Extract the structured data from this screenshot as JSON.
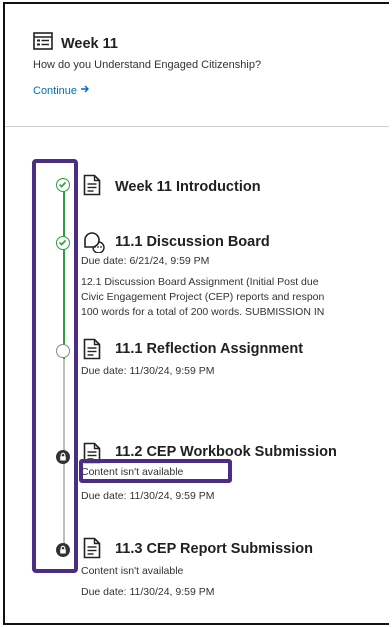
{
  "header": {
    "title": "Week 11",
    "subtitle": "How do you Understand Engaged Citizenship?",
    "continue_label": "Continue"
  },
  "items": [
    {
      "title": "Week 11 Introduction",
      "status": "completed"
    },
    {
      "title": "11.1 Discussion Board",
      "due": "Due date: 6/21/24, 9:59 PM",
      "description": [
        "12.1 Discussion Board Assignment (Initial Post due",
        "Civic Engagement Project (CEP) reports and respon",
        "100 words for a total of 200 words. SUBMISSION IN"
      ],
      "status": "completed"
    },
    {
      "title": "11.1 Reflection Assignment",
      "due": "Due date: 11/30/24, 9:59 PM",
      "status": "not-started"
    },
    {
      "title": "11.2 CEP Workbook Submission",
      "availability": "Content isn't available",
      "due": "Due date: 11/30/24, 9:59 PM",
      "status": "locked"
    },
    {
      "title": "11.3 CEP Report Submission",
      "availability": "Content isn't available",
      "due": "Due date: 11/30/24, 9:59 PM",
      "status": "locked"
    }
  ],
  "colors": {
    "completed": "#2e9e3f",
    "line_gray": "#bdbdbd",
    "highlight": "#4b2e83",
    "link": "#006fbf"
  }
}
